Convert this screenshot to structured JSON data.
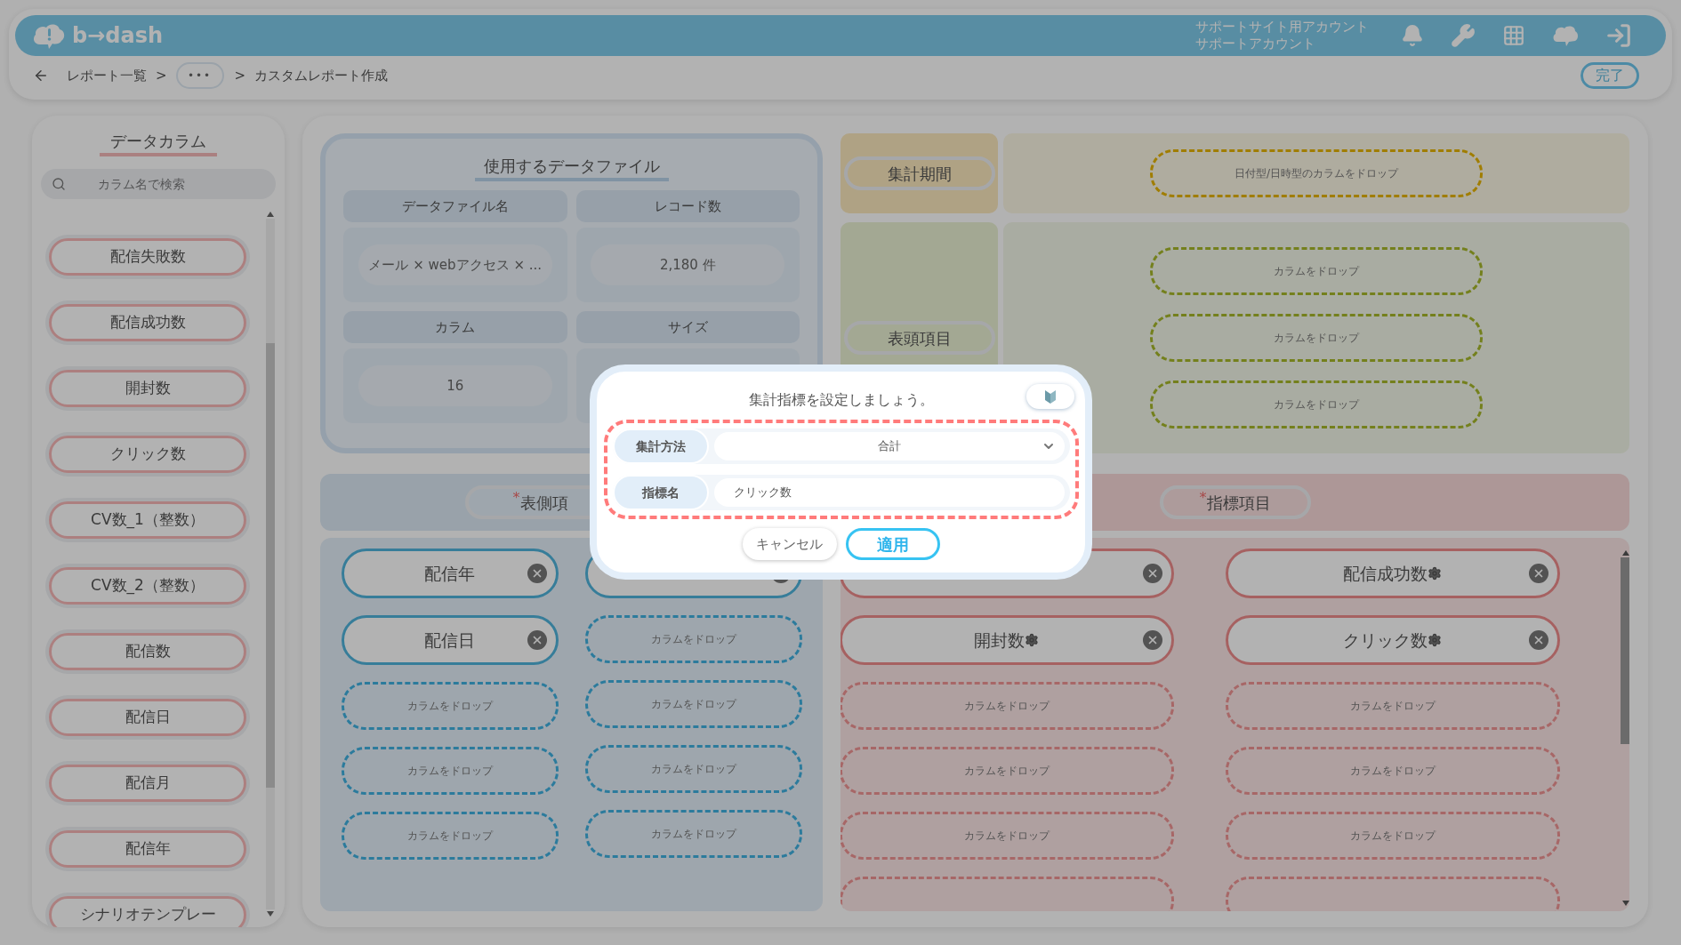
{
  "header": {
    "logo": "b→dash",
    "account_lines": [
      "サポートサイト用アカウント",
      "サポートアカウント"
    ]
  },
  "breadcrumb": [
    {
      "kind": "back"
    },
    {
      "kind": "link",
      "text": "レポート一覧"
    },
    {
      "kind": "sep",
      "text": ">"
    },
    {
      "kind": "more",
      "text": "•••"
    },
    {
      "kind": "sep",
      "text": ">"
    },
    {
      "kind": "current",
      "text": "カスタムレポート作成"
    }
  ],
  "done_button": "完了",
  "column_panel": {
    "title": "データカラム",
    "search_placeholder": "カラム名で検索",
    "items": [
      "配信失敗数",
      "配信成功数",
      "開封数",
      "クリック数",
      "CV数_1（整数）",
      "CV数_2（整数）",
      "配信数",
      "配信日",
      "配信月",
      "配信年",
      "シナリオテンプレー"
    ]
  },
  "data_file": {
    "title": "使用するデータファイル",
    "fields": [
      {
        "label": "データファイル名",
        "value": "メール × webアクセス × ..."
      },
      {
        "label": "レコード数",
        "value": "2,180 件"
      },
      {
        "label": "カラム",
        "value": "16"
      },
      {
        "label": "サイズ"
      }
    ]
  },
  "period": {
    "label": "集計期間",
    "dropzone": "日付型/日時型のカラムをドロップ"
  },
  "column_header": {
    "label": "表頭項目",
    "dropzones": [
      "カラムをドロップ",
      "カラムをドロップ",
      "カラムをドロップ"
    ]
  },
  "row_items": {
    "label": "表側項",
    "required_mark": "*",
    "columns": [
      [
        {
          "kind": "chip",
          "text": "配信年"
        },
        {
          "kind": "chip",
          "text": "配信日"
        },
        {
          "kind": "drop",
          "text": "カラムをドロップ"
        },
        {
          "kind": "drop",
          "text": "カラムをドロップ"
        },
        {
          "kind": "drop",
          "text": "カラムをドロップ"
        }
      ],
      [
        {
          "kind": "chip"
        },
        {
          "kind": "drop",
          "text": "カラムをドロップ"
        },
        {
          "kind": "drop",
          "text": "カラムをドロップ"
        },
        {
          "kind": "drop",
          "text": "カラムをドロップ"
        },
        {
          "kind": "drop",
          "text": "カラムをドロップ"
        }
      ]
    ]
  },
  "metric_items": {
    "label": "指標項目",
    "required_mark": "*",
    "columns": [
      [
        {
          "kind": "chip"
        },
        {
          "kind": "chip",
          "text": "開封数",
          "settings": true
        },
        {
          "kind": "drop",
          "text": "カラムをドロップ"
        },
        {
          "kind": "drop",
          "text": "カラムをドロップ"
        },
        {
          "kind": "drop",
          "text": "カラムをドロップ"
        },
        {
          "kind": "cut"
        }
      ],
      [
        {
          "kind": "chip",
          "text": "配信成功数",
          "settings": true
        },
        {
          "kind": "chip",
          "text": "クリック数",
          "settings": true
        },
        {
          "kind": "drop",
          "text": "カラムをドロップ"
        },
        {
          "kind": "drop",
          "text": "カラムをドロップ"
        },
        {
          "kind": "drop",
          "text": "カラムをドロップ"
        },
        {
          "kind": "cut"
        }
      ]
    ]
  },
  "dialog": {
    "title": "集計指標を設定しましょう。",
    "fields": [
      {
        "label": "集計方法",
        "kind": "select",
        "value": "合計"
      },
      {
        "label": "指標名",
        "kind": "input",
        "value": "クリック数"
      }
    ],
    "buttons": [
      {
        "text": "キャンセル",
        "primary": false
      },
      {
        "text": "適用",
        "primary": true
      }
    ]
  }
}
